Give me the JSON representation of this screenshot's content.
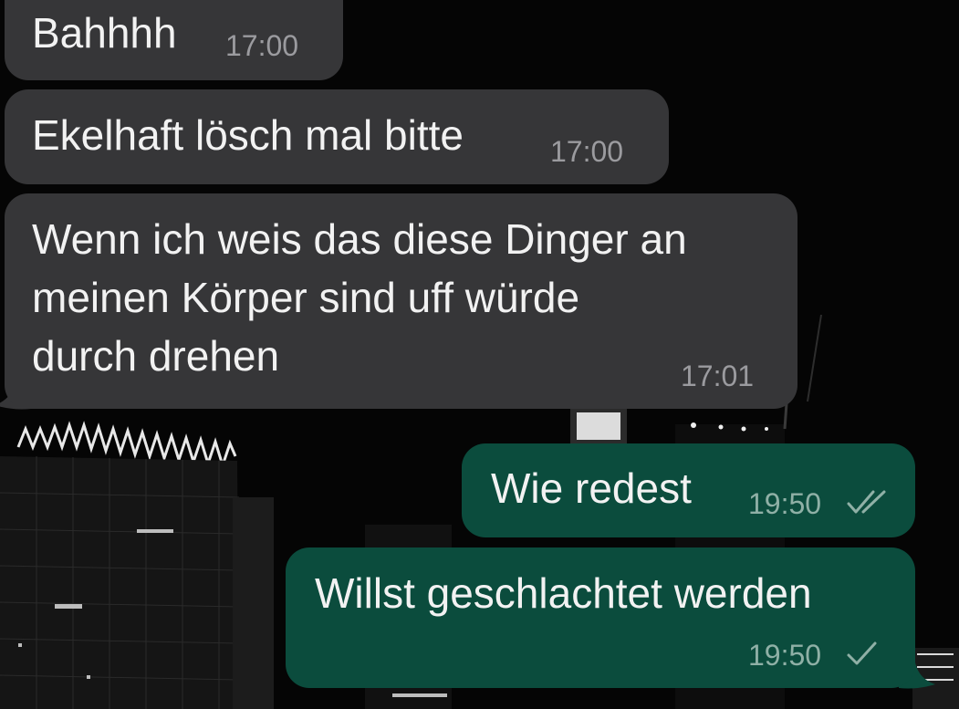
{
  "messages": [
    {
      "direction": "incoming",
      "text": "Bahhhh",
      "time": "17:00"
    },
    {
      "direction": "incoming",
      "text": "Ekelhaft lösch mal bitte",
      "time": "17:00"
    },
    {
      "direction": "incoming",
      "text": "Wenn ich weis das diese Dinger an\nmeinen Körper sind uff würde\ndurch drehen",
      "time": "17:01"
    },
    {
      "direction": "outgoing",
      "text": "Wie redest",
      "time": "19:50",
      "status_icon": "double-check-icon",
      "status": "read"
    },
    {
      "direction": "outgoing",
      "text": "Willst geschlachtet werden",
      "time": "19:50",
      "status_icon": "single-check-icon",
      "status": "sent"
    }
  ],
  "colors": {
    "incoming_bubble": "#363638",
    "outgoing_bubble": "#0b4c3d",
    "background": "#050505"
  }
}
